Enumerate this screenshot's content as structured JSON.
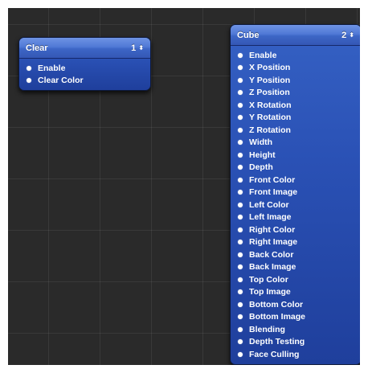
{
  "patches": [
    {
      "title": "Clear",
      "index": "1",
      "stepper": "⬍",
      "inputs": [
        "Enable",
        "Clear Color"
      ]
    },
    {
      "title": "Cube",
      "index": "2",
      "stepper": "⬍",
      "inputs": [
        "Enable",
        "X Position",
        "Y Position",
        "Z Position",
        "X Rotation",
        "Y Rotation",
        "Z Rotation",
        "Width",
        "Height",
        "Depth",
        "Front Color",
        "Front Image",
        "Left Color",
        "Left Image",
        "Right Color",
        "Right Image",
        "Back Color",
        "Back Image",
        "Top Color",
        "Top Image",
        "Bottom Color",
        "Bottom Image",
        "Blending",
        "Depth Testing",
        "Face Culling"
      ]
    }
  ],
  "colors": {
    "canvas": "#2a2a2a",
    "patch_header": "#5079d6",
    "patch_body": "#2a51b5",
    "port_text": "#ffffff"
  }
}
